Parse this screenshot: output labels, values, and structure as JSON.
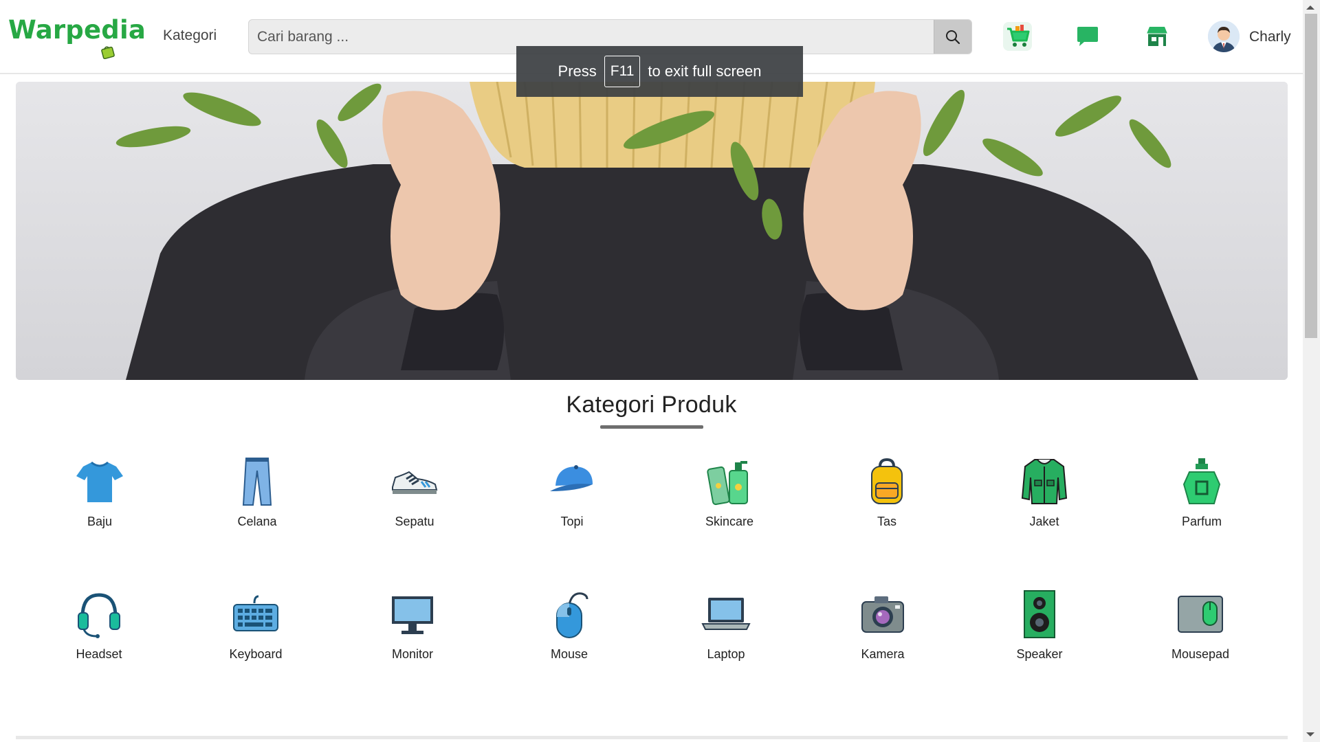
{
  "brand": {
    "name": "Warpedia"
  },
  "nav": {
    "kategori_label": "Kategori"
  },
  "search": {
    "placeholder": "Cari barang ..."
  },
  "user": {
    "name": "Charly"
  },
  "toast": {
    "prefix": "Press",
    "key": "F11",
    "suffix": "to exit full screen"
  },
  "categories_section": {
    "title": "Kategori Produk",
    "row1": [
      {
        "label": "Baju",
        "icon": "shirt-icon"
      },
      {
        "label": "Celana",
        "icon": "pants-icon"
      },
      {
        "label": "Sepatu",
        "icon": "shoe-icon"
      },
      {
        "label": "Topi",
        "icon": "cap-icon"
      },
      {
        "label": "Skincare",
        "icon": "skincare-icon"
      },
      {
        "label": "Tas",
        "icon": "backpack-icon"
      },
      {
        "label": "Jaket",
        "icon": "jacket-icon"
      },
      {
        "label": "Parfum",
        "icon": "perfume-icon"
      }
    ],
    "row2": [
      {
        "label": "Headset",
        "icon": "headset-icon"
      },
      {
        "label": "Keyboard",
        "icon": "keyboard-icon"
      },
      {
        "label": "Monitor",
        "icon": "monitor-icon"
      },
      {
        "label": "Mouse",
        "icon": "mouse-icon"
      },
      {
        "label": "Laptop",
        "icon": "laptop-icon"
      },
      {
        "label": "Kamera",
        "icon": "camera-icon"
      },
      {
        "label": "Speaker",
        "icon": "speaker-icon"
      },
      {
        "label": "Mousepad",
        "icon": "mousepad-icon"
      }
    ]
  },
  "colors": {
    "brand_green": "#27a844",
    "icon_green": "#1db954",
    "toast_bg": "#3c4043"
  }
}
